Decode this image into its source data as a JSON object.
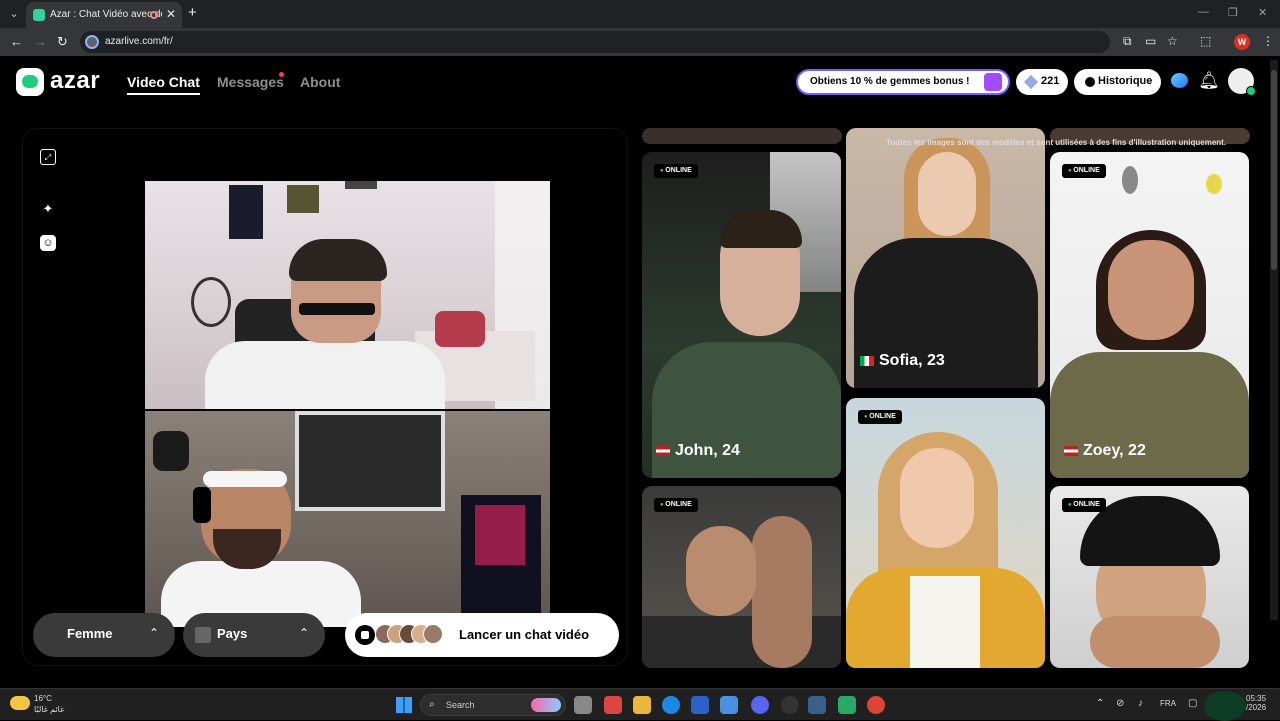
{
  "browser": {
    "tab_title": "Azar : Chat Vidéo avec de n",
    "url": "azarlive.com/fr/",
    "profile_initial": "W"
  },
  "header": {
    "logo_text": "azar",
    "nav": [
      "Video Chat",
      "Messages",
      "About"
    ],
    "active_nav": "Video Chat",
    "promo_text": "Obtiens 10 % de gemmes bonus !",
    "gems_count": "221",
    "history_label": "Historique"
  },
  "video_panel": {
    "gender_filter": "Femme",
    "country_filter": "Pays",
    "start_label": "Lancer un chat vidéo"
  },
  "gallery": {
    "disclaimer": "Toutes les images sont des modèles et sont utilisées à des fins d'illustration uniquement.",
    "online_label": "ONLINE",
    "cards": [
      {
        "name": "John, 24",
        "country": "US",
        "online": true
      },
      {
        "name": "Sofia, 23",
        "country": "IT",
        "online": false
      },
      {
        "name": "Zoey, 22",
        "country": "US",
        "online": true
      },
      {
        "name": "",
        "online": true
      },
      {
        "name": "",
        "online": true
      },
      {
        "name": "",
        "online": true
      }
    ]
  },
  "taskbar": {
    "weather_temp": "16°C",
    "weather_desc": "غائم غالبًا",
    "search_placeholder": "Search",
    "lang": "FRA",
    "time": "05:35",
    "date": "/2026"
  },
  "colors": {
    "accent_green": "#1fce7c",
    "online_dot": "#36d399",
    "promo_border": "#7b5cff"
  }
}
